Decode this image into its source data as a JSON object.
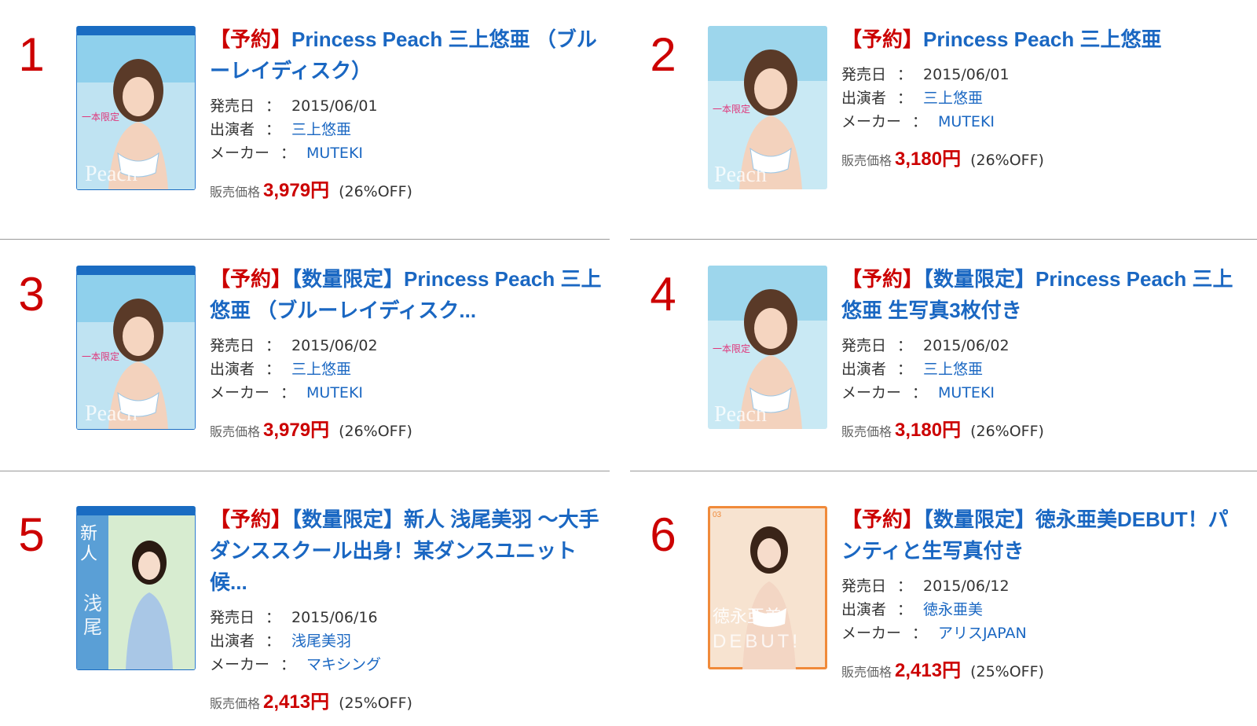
{
  "colors": {
    "rank": "#cc0000",
    "link": "#1a67c2",
    "price": "#cc0000",
    "divider": "#999999"
  },
  "labels": {
    "release": "発売日",
    "performer": "出演者",
    "maker": "メーカー",
    "separator": "：",
    "price_label": "販売価格"
  },
  "items": [
    {
      "rank": "1",
      "badges": [
        "【予約】"
      ],
      "title": "Princess Peach 三上悠亜 （ブルーレイディスク）",
      "cover_icon": "bluray-cover-image",
      "release": "2015/06/01",
      "performer": "三上悠亜",
      "maker": "MUTEKI",
      "price": "3,979円",
      "discount": "(26%OFF)"
    },
    {
      "rank": "2",
      "badges": [
        "【予約】"
      ],
      "title": "Princess Peach 三上悠亜",
      "cover_icon": "dvd-cover-image",
      "release": "2015/06/01",
      "performer": "三上悠亜",
      "maker": "MUTEKI",
      "price": "3,180円",
      "discount": "(26%OFF)"
    },
    {
      "rank": "3",
      "badges": [
        "【予約】",
        "【数量限定】"
      ],
      "title": "Princess Peach 三上悠亜 （ブルーレイディスク...",
      "cover_icon": "bluray-cover-image",
      "release": "2015/06/02",
      "performer": "三上悠亜",
      "maker": "MUTEKI",
      "price": "3,979円",
      "discount": "(26%OFF)"
    },
    {
      "rank": "4",
      "badges": [
        "【予約】",
        "【数量限定】"
      ],
      "title": "Princess Peach 三上悠亜 生写真3枚付き",
      "cover_icon": "dvd-cover-image",
      "release": "2015/06/02",
      "performer": "三上悠亜",
      "maker": "MUTEKI",
      "price": "3,180円",
      "discount": "(26%OFF)"
    },
    {
      "rank": "5",
      "badges": [
        "【予約】",
        "【数量限定】"
      ],
      "title": "新人 浅尾美羽 〜大手ダンススクール出身！某ダンスユニット候...",
      "cover_icon": "bluray-cover-image",
      "release": "2015/06/16",
      "performer": "浅尾美羽",
      "maker": "マキシング",
      "price": "2,413円",
      "discount": "(25%OFF)"
    },
    {
      "rank": "6",
      "badges": [
        "【予約】",
        "【数量限定】"
      ],
      "title": "徳永亜美DEBUT！パンティと生写真付き",
      "cover_icon": "dvd-cover-image",
      "release": "2015/06/12",
      "performer": "徳永亜美",
      "maker": "アリスJAPAN",
      "price": "2,413円",
      "discount": "(25%OFF)"
    }
  ]
}
